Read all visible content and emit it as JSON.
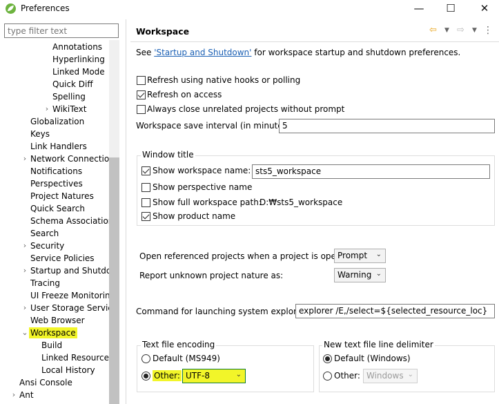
{
  "window": {
    "title": "Preferences",
    "min_glyph": "—",
    "max_glyph": "☐",
    "close_glyph": "✕"
  },
  "filter": {
    "placeholder": "type filter text"
  },
  "tree": {
    "items": [
      {
        "label": "Annotations"
      },
      {
        "label": "Hyperlinking"
      },
      {
        "label": "Linked Mode"
      },
      {
        "label": "Quick Diff"
      },
      {
        "label": "Spelling"
      },
      {
        "label": "WikiText"
      },
      {
        "label": "Globalization"
      },
      {
        "label": "Keys"
      },
      {
        "label": "Link Handlers"
      },
      {
        "label": "Network Connections"
      },
      {
        "label": "Notifications"
      },
      {
        "label": "Perspectives"
      },
      {
        "label": "Project Natures"
      },
      {
        "label": "Quick Search"
      },
      {
        "label": "Schema Associations"
      },
      {
        "label": "Search"
      },
      {
        "label": "Security"
      },
      {
        "label": "Service Policies"
      },
      {
        "label": "Startup and Shutdown"
      },
      {
        "label": "Tracing"
      },
      {
        "label": "UI Freeze Monitoring"
      },
      {
        "label": "User Storage Service"
      },
      {
        "label": "Web Browser"
      },
      {
        "label": "Workspace"
      },
      {
        "label": "Build"
      },
      {
        "label": "Linked Resources"
      },
      {
        "label": "Local History"
      },
      {
        "label": "Ansi Console"
      },
      {
        "label": "Ant"
      }
    ]
  },
  "page": {
    "title": "Workspace",
    "intro_prefix": "See ",
    "intro_link": "'Startup and Shutdown'",
    "intro_suffix": " for workspace startup and shutdown preferences.",
    "refresh_native": "Refresh using native hooks or polling",
    "refresh_access": "Refresh on access",
    "always_close": "Always close unrelated projects without prompt",
    "save_interval_label": "Workspace save interval (in minutes):",
    "save_interval_value": "5",
    "window_title": {
      "group_label": "Window title",
      "show_name_label": "Show workspace name:",
      "workspace_name_value": "sts5_workspace",
      "show_perspective": "Show perspective name",
      "show_full_path_label": "Show full workspace path:",
      "full_path_value": "D:₩sts5_workspace",
      "show_product": "Show product name"
    },
    "open_ref_label": "Open referenced projects when a project is opened:",
    "open_ref_value": "Prompt",
    "report_unknown_label": "Report unknown project nature as:",
    "report_unknown_value": "Warning",
    "explorer_label": "Command for launching system explorer:",
    "explorer_value": "explorer /E,/select=${selected_resource_loc}",
    "encoding": {
      "group_label": "Text file encoding",
      "default_label": "Default (MS949)",
      "other_label": "Other:",
      "other_value": "UTF-8"
    },
    "delimiter": {
      "group_label": "New text file line delimiter",
      "default_label": "Default (Windows)",
      "other_label": "Other:",
      "other_value": "Windows"
    }
  },
  "colors": {
    "highlight": "#f2f529",
    "link": "#1a5fb4"
  }
}
